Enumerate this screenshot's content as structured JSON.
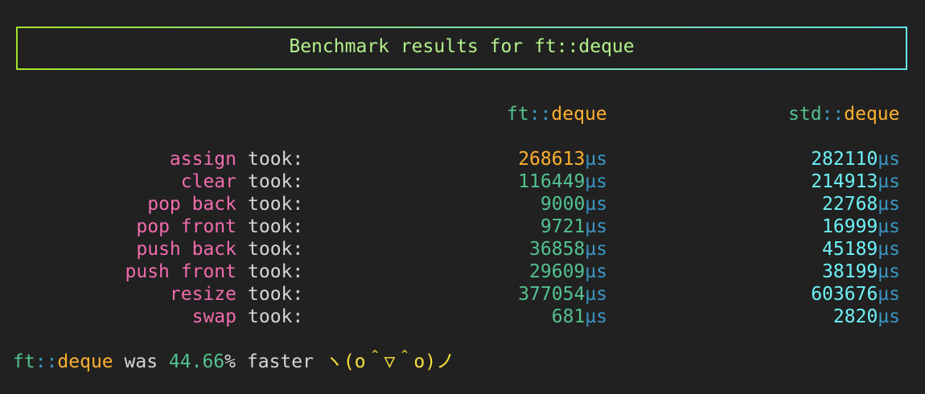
{
  "banner": {
    "title": "Benchmark results for ft::deque"
  },
  "headers": {
    "ft": {
      "ns": "ft",
      "sep": "::",
      "name": "deque"
    },
    "std": {
      "ns": "std",
      "sep": "::",
      "name": "deque"
    }
  },
  "took_label": "took:",
  "unit": "µs",
  "rows": [
    {
      "name": "assign",
      "ft": "268613",
      "std": "282110"
    },
    {
      "name": "clear",
      "ft": "116449",
      "std": "214913"
    },
    {
      "name": "pop back",
      "ft": "9000",
      "std": "22768"
    },
    {
      "name": "pop front",
      "ft": "9721",
      "std": "16999"
    },
    {
      "name": "push back",
      "ft": "36858",
      "std": "45189"
    },
    {
      "name": "push front",
      "ft": "29609",
      "std": "38199"
    },
    {
      "name": "resize",
      "ft": "377054",
      "std": "603676"
    },
    {
      "name": "swap",
      "ft": "681",
      "std": "2820"
    }
  ],
  "summary": {
    "ns": "ft",
    "sep": "::",
    "name": "deque",
    "was": "was",
    "percent": "44.66",
    "percent_sign": "%",
    "faster": "faster",
    "kaomoji": "ヽ(o＾▽＾o)ノ"
  },
  "colors": {
    "background": "#212121",
    "label": "#f06cae",
    "ft_value": "#53c28e",
    "ft_highlight": "#ffb02e",
    "std_value": "#6ef2f6",
    "unit": "#3a96c4"
  }
}
